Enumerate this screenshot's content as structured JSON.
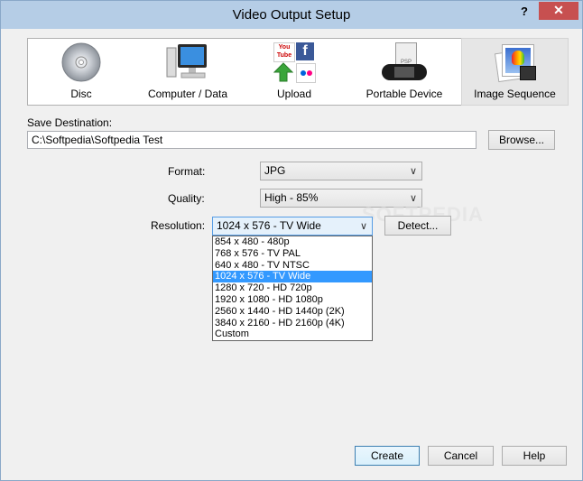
{
  "window": {
    "title": "Video Output Setup",
    "help_label": "?",
    "close_label": "✕"
  },
  "topbar": {
    "items": [
      {
        "label": "Disc",
        "icon": "disc-icon"
      },
      {
        "label": "Computer / Data",
        "icon": "computer-icon"
      },
      {
        "label": "Upload",
        "icon": "upload-icon"
      },
      {
        "label": "Portable Device",
        "icon": "portable-device-icon"
      },
      {
        "label": "Image Sequence",
        "icon": "image-sequence-icon",
        "selected": true
      }
    ],
    "upload_badges": {
      "youtube": "You Tube",
      "facebook": "f",
      "psp": "PSP"
    }
  },
  "save_destination": {
    "label": "Save Destination:",
    "value": "C:\\Softpedia\\Softpedia Test",
    "browse_label": "Browse..."
  },
  "format": {
    "label": "Format:",
    "value": "JPG"
  },
  "quality": {
    "label": "Quality:",
    "value": "High - 85%"
  },
  "resolution": {
    "label": "Resolution:",
    "value": "1024 x 576 - TV Wide",
    "detect_label": "Detect...",
    "options": [
      "854 x 480 - 480p",
      "768 x 576 - TV PAL",
      "640 x 480 - TV NTSC",
      "1024 x 576 - TV Wide",
      "1280 x 720 - HD 720p",
      "1920 x 1080 - HD 1080p",
      "2560 x 1440 - HD 1440p (2K)",
      "3840 x 2160 - HD 2160p (4K)",
      "Custom"
    ],
    "selected_index": 3
  },
  "watermark": "SOFTPEDIA",
  "buttons": {
    "create": "Create",
    "cancel": "Cancel",
    "help": "Help"
  },
  "colors": {
    "titlebar": "#b5cde6",
    "close": "#c75050",
    "selection": "#3399ff"
  }
}
